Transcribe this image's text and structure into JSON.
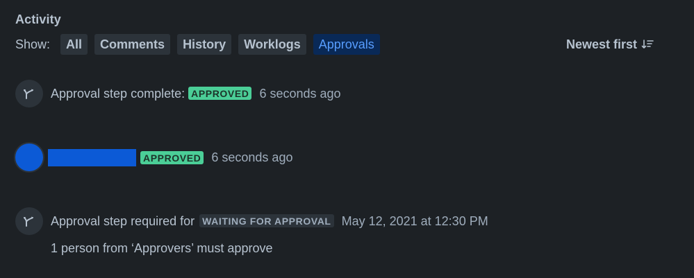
{
  "activity": {
    "title": "Activity",
    "show_label": "Show:",
    "filters": [
      {
        "label": "All",
        "active": false
      },
      {
        "label": "Comments",
        "active": false
      },
      {
        "label": "History",
        "active": false
      },
      {
        "label": "Worklogs",
        "active": false
      },
      {
        "label": "Approvals",
        "active": true
      }
    ],
    "sort_label": "Newest first",
    "sort_icon": "sort-descending-icon"
  },
  "items": [
    {
      "icon": "branch-icon",
      "text": "Approval step complete:",
      "lozenge": "APPROVED",
      "time": "6 seconds ago"
    },
    {
      "icon": "avatar",
      "lozenge": "APPROVED",
      "time": "6 seconds ago"
    },
    {
      "icon": "branch-icon",
      "text": "Approval step required for",
      "lozenge": "WAITING FOR APPROVAL",
      "time": "May 12, 2021 at 12:30 PM",
      "subtext": "1 person from ‘Approvers’ must approve"
    }
  ],
  "colors": {
    "background": "#1d2125",
    "text": "#b6c2cf",
    "approved_lozenge": "#4bce97",
    "active_filter_bg": "#092957",
    "active_filter_text": "#579dff",
    "avatar": "#0c5ad6"
  }
}
